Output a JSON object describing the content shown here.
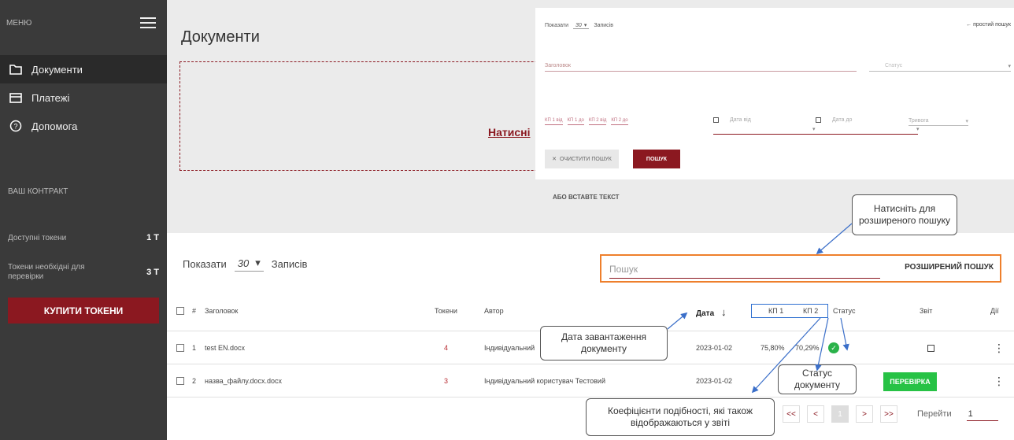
{
  "sidebar": {
    "menu_label": "МЕНЮ",
    "items": [
      {
        "label": "Документи",
        "icon": "folder-icon"
      },
      {
        "label": "Платежі",
        "icon": "card-icon"
      },
      {
        "label": "Допомога",
        "icon": "help-icon"
      }
    ],
    "contract_label": "ВАШ КОНТРАКТ",
    "tokens_available_label": "Доступні токени",
    "tokens_available_value": "1 Т",
    "tokens_needed_label": "Токени необхідні для перевірки",
    "tokens_needed_value": "3 Т",
    "buy_button": "КУПИТИ ТОКЕНИ"
  },
  "main": {
    "title": "Документи",
    "drop_link": "Натисні",
    "paste_text": "АБО ВСТАВТЕ ТЕКСТ"
  },
  "advanced_search": {
    "show_label": "Показати",
    "show_value": "30",
    "records_label": "Записів",
    "simple_search": "← простий пошук",
    "title_placeholder": "Заголовок",
    "status_placeholder": "Статус",
    "kp_fields": [
      "КП 1 від",
      "КП 1 до",
      "КП 2 від",
      "КП 2 до"
    ],
    "date_from": "Дата від",
    "date_to": "Дата до",
    "alarm": "Тривога",
    "clear_button": "ОЧИСТИТИ ПОШУК",
    "search_button": "ПОШУК"
  },
  "callouts": {
    "advanced": "Натисніть для розширеного пошуку",
    "upload_date": "Дата завантаження документу",
    "status": "Статус документу",
    "coefficients": "Коефіцієнти подібності, які також відображаються у звіті"
  },
  "table_toolbar": {
    "show_label": "Показати",
    "show_value": "30",
    "records_label": "Записів",
    "search_placeholder": "Пошук",
    "advanced_button": "РОЗШИРЕНИЙ ПОШУК"
  },
  "table": {
    "headers": {
      "number": "#",
      "title": "Заголовок",
      "tokens": "Токени",
      "author": "Автор",
      "date": "Дата",
      "kp1": "КП 1",
      "kp2": "КП 2",
      "status": "Статус",
      "report": "Звіт",
      "actions": "Дії"
    },
    "rows": [
      {
        "num": "1",
        "title": "test EN.docx",
        "tokens": "4",
        "author": "Індивідуальний",
        "date": "2023-01-02",
        "kp1": "75,80%",
        "kp2": "70,29%"
      },
      {
        "num": "2",
        "title": "назва_файлу.docx.docx",
        "tokens": "3",
        "author": "Індивідуальний користувач Тестовий",
        "date": "2023-01-02",
        "action": "ПЕРЕВІРКА"
      }
    ]
  },
  "pagination": {
    "first": "<<",
    "prev": "<",
    "current": "1",
    "next": ">",
    "last": ">>",
    "goto_label": "Перейти",
    "goto_value": "1"
  },
  "colors": {
    "brand": "#8b1820",
    "sidebar": "#3a3a3a",
    "success": "#27c245",
    "highlight_orange": "#ee7f2c",
    "highlight_blue": "#2e6fd0"
  }
}
